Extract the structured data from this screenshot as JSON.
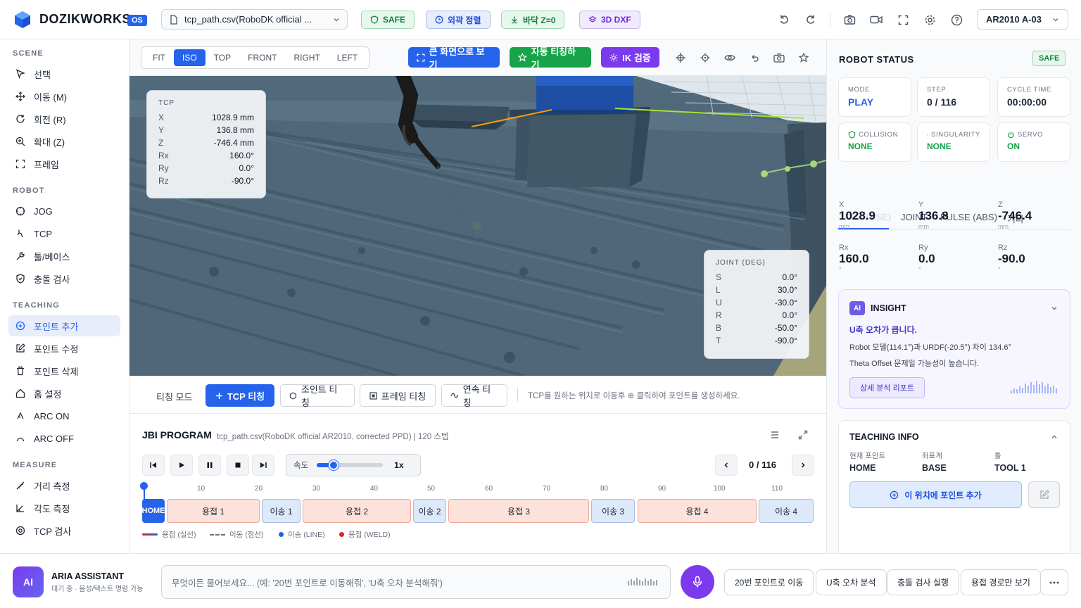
{
  "app": {
    "brand": "DOZIKWORKS",
    "os_badge": "OS"
  },
  "header": {
    "file_name": "tcp_path.csv(RoboDK official ...",
    "pills": {
      "safe": "SAFE",
      "outline": "외곽 정렬",
      "floor": "바닥 Z=0",
      "dxf": "3D DXF"
    },
    "robot_model": "AR2010 A-03"
  },
  "sidebar": {
    "sections": {
      "scene": "SCENE",
      "robot": "ROBOT",
      "teaching": "TEACHING",
      "measure": "MEASURE"
    },
    "scene": [
      "선택",
      "이동 (M)",
      "회전 (R)",
      "확대 (Z)",
      "프레임"
    ],
    "robot": [
      "JOG",
      "TCP",
      "툴/베이스",
      "충돌 검사"
    ],
    "teaching": [
      "포인트 추가",
      "포인트 수정",
      "포인트 삭제",
      "홈 설정",
      "ARC ON",
      "ARC OFF"
    ],
    "measure": [
      "거리 측정",
      "각도 측정",
      "TCP 검사"
    ]
  },
  "viewport": {
    "views": [
      "FIT",
      "ISO",
      "TOP",
      "FRONT",
      "RIGHT",
      "LEFT"
    ],
    "active_view": "ISO",
    "actions": {
      "fullscreen": "큰 화면으로 보기",
      "auto_teach": "자동 티칭하기",
      "ik_check": "IK 검증"
    },
    "tcp_panel": {
      "title": "TCP",
      "rows": [
        {
          "k": "X",
          "v": "1028.9 mm"
        },
        {
          "k": "Y",
          "v": "136.8 mm"
        },
        {
          "k": "Z",
          "v": "-746.4 mm"
        },
        {
          "k": "Rx",
          "v": "160.0°"
        },
        {
          "k": "Ry",
          "v": "0.0°"
        },
        {
          "k": "Rz",
          "v": "-90.0°"
        }
      ]
    },
    "joint_panel": {
      "title": "JOINT (DEG)",
      "rows": [
        {
          "k": "S",
          "v": "0.0°"
        },
        {
          "k": "L",
          "v": "30.0°"
        },
        {
          "k": "U",
          "v": "-30.0°"
        },
        {
          "k": "R",
          "v": "0.0°"
        },
        {
          "k": "B",
          "v": "-50.0°"
        },
        {
          "k": "T",
          "v": "-90.0°"
        }
      ]
    }
  },
  "teach_bar": {
    "mode_label": "티칭 모드",
    "buttons": [
      "TCP 티칭",
      "조인트 티칭",
      "프레임 티칭",
      "연속 티칭"
    ],
    "hint": "TCP를 원하는 위치로 이동후 ⊕ 클릭하여 포인트를 생성하세요."
  },
  "program": {
    "title": "JBI PROGRAM",
    "subtitle": "tcp_path.csv(RoboDK official AR2010, corrected PPD) | 120 스텝",
    "speed_label": "속도",
    "speed_value": "1x",
    "speed_fraction": 0.25,
    "step_counter": "0 / 116",
    "ticks": [
      "10",
      "20",
      "30",
      "40",
      "50",
      "60",
      "70",
      "80",
      "90",
      "100",
      "110"
    ],
    "segments": {
      "home": "HOME",
      "weld1": "용접 1",
      "move1": "이송 1",
      "weld2": "용접 2",
      "move2": "이송 2",
      "weld3": "용접 3",
      "move3": "이송 3",
      "weld4": "용접 4",
      "move4": "이송 4"
    },
    "legend": [
      "용접 (실선)",
      "이동 (점선)",
      "이송 (LINE)",
      "용접 (WELD)"
    ]
  },
  "robot_status": {
    "title": "ROBOT STATUS",
    "badge": "SAFE",
    "cards": [
      {
        "label": "MODE",
        "value": "PLAY"
      },
      {
        "label": "STEP",
        "value": "0 / 116"
      },
      {
        "label": "CYCLE TIME",
        "value": "00:00:00"
      },
      {
        "label": "COLLISION",
        "value": "NONE"
      },
      {
        "label": "SINGULARITY",
        "value": "NONE"
      },
      {
        "label": "SERVO",
        "value": "ON"
      }
    ],
    "tabs": [
      "TCP (BASE)",
      "JOINT",
      "PULSE (ABS)",
      "기타"
    ],
    "coords": [
      {
        "k": "X",
        "v": "1028.9",
        "u": "mm"
      },
      {
        "k": "Y",
        "v": "136.8",
        "u": "mm"
      },
      {
        "k": "Z",
        "v": "-746.4",
        "u": "mm"
      },
      {
        "k": "Rx",
        "v": "160.0",
        "u": "°"
      },
      {
        "k": "Ry",
        "v": "0.0",
        "u": "°"
      },
      {
        "k": "Rz",
        "v": "-90.0",
        "u": "°"
      }
    ]
  },
  "insight": {
    "badge": "AI",
    "title": "INSIGHT",
    "headline": "U축 오차가 큽니다.",
    "line1": "Robot 모델(114.1°)과 URDF(-20.5°) 차이 134.6°",
    "line2": "Theta Offset 문제일 가능성이 높습니다.",
    "button": "상세 분석 리포트"
  },
  "teaching_info": {
    "title": "TEACHING INFO",
    "fields": [
      {
        "label": "현재 포인트",
        "value": "HOME"
      },
      {
        "label": "좌표계",
        "value": "BASE"
      },
      {
        "label": "툴",
        "value": "TOOL 1"
      }
    ],
    "add_button": "이 위치에 포인트 추가"
  },
  "assistant": {
    "avatar": "AI",
    "name": "ARIA ASSISTANT",
    "status": "대기 중 · 음성/텍스트 명령 가능",
    "placeholder": "무엇이든 물어보세요... (예: '20번 포인트로 이동해줘', 'U축 오차 분석해줘')",
    "quick": [
      "20번 포인트로 이동",
      "U축 오차 분석",
      "충돌 검사 실행",
      "용접 경로만 보기"
    ]
  },
  "colors": {
    "accent": "#2563eb",
    "safe": "#16a34a",
    "ai_purple": "#7c3aed",
    "weld": "#dc2626",
    "move_line": "#2563eb"
  }
}
